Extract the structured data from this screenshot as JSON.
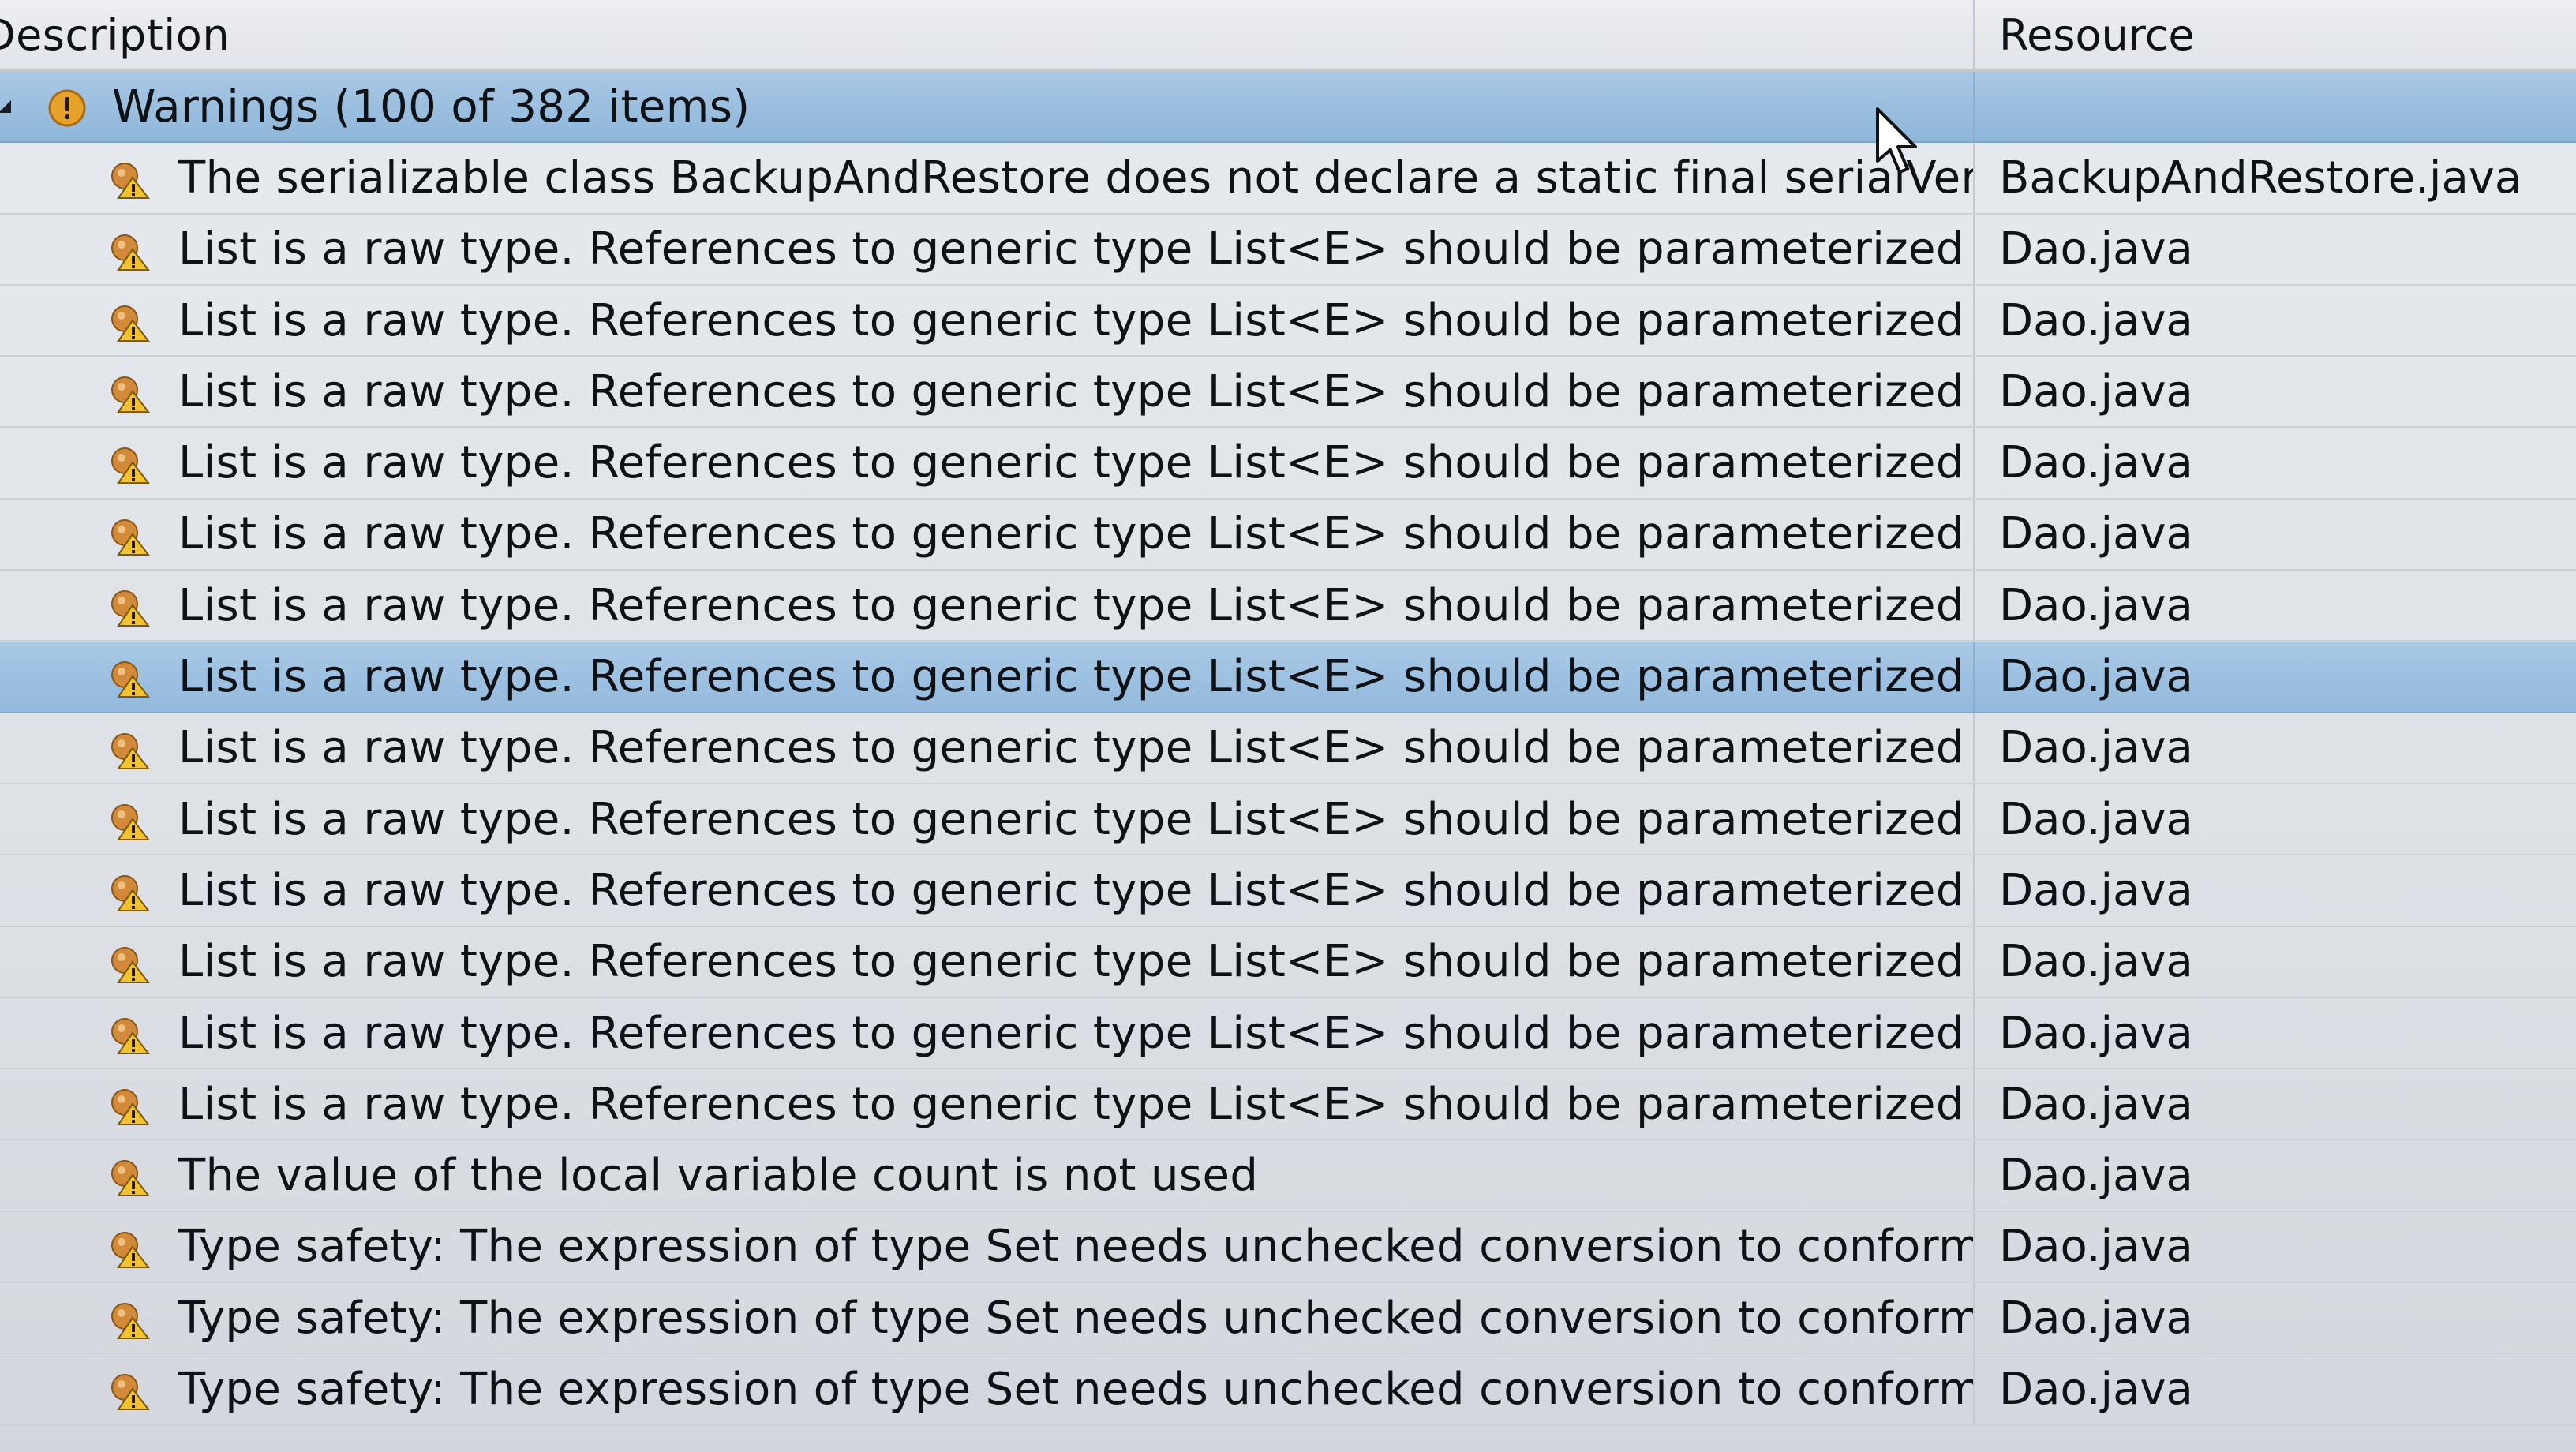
{
  "columns": {
    "description": "Description",
    "resource": "Resource"
  },
  "group": {
    "label": "Warnings (100 of 382 items)",
    "icon": "warning-icon"
  },
  "rows": [
    {
      "description": "The serializable class BackupAndRestore does not declare a static final serialVersionUID",
      "resource": "BackupAndRestore.java",
      "selected": false
    },
    {
      "description": "List is a raw type. References to generic type List<E> should be parameterized",
      "resource": "Dao.java",
      "selected": false
    },
    {
      "description": "List is a raw type. References to generic type List<E> should be parameterized",
      "resource": "Dao.java",
      "selected": false
    },
    {
      "description": "List is a raw type. References to generic type List<E> should be parameterized",
      "resource": "Dao.java",
      "selected": false
    },
    {
      "description": "List is a raw type. References to generic type List<E> should be parameterized",
      "resource": "Dao.java",
      "selected": false
    },
    {
      "description": "List is a raw type. References to generic type List<E> should be parameterized",
      "resource": "Dao.java",
      "selected": false
    },
    {
      "description": "List is a raw type. References to generic type List<E> should be parameterized",
      "resource": "Dao.java",
      "selected": false
    },
    {
      "description": "List is a raw type. References to generic type List<E> should be parameterized",
      "resource": "Dao.java",
      "selected": true
    },
    {
      "description": "List is a raw type. References to generic type List<E> should be parameterized",
      "resource": "Dao.java",
      "selected": false
    },
    {
      "description": "List is a raw type. References to generic type List<E> should be parameterized",
      "resource": "Dao.java",
      "selected": false
    },
    {
      "description": "List is a raw type. References to generic type List<E> should be parameterized",
      "resource": "Dao.java",
      "selected": false
    },
    {
      "description": "List is a raw type. References to generic type List<E> should be parameterized",
      "resource": "Dao.java",
      "selected": false
    },
    {
      "description": "List is a raw type. References to generic type List<E> should be parameterized",
      "resource": "Dao.java",
      "selected": false
    },
    {
      "description": "List is a raw type. References to generic type List<E> should be parameterized",
      "resource": "Dao.java",
      "selected": false
    },
    {
      "description": "The value of the local variable count is not used",
      "resource": "Dao.java",
      "selected": false
    },
    {
      "description": "Type safety: The expression of type Set needs unchecked conversion to conform to Set<String>",
      "resource": "Dao.java",
      "selected": false
    },
    {
      "description": "Type safety: The expression of type Set needs unchecked conversion to conform to Set<String>",
      "resource": "Dao.java",
      "selected": false
    },
    {
      "description": "Type safety: The expression of type Set needs unchecked conversion to conform to Set<String>",
      "resource": "Dao.java",
      "selected": false
    }
  ],
  "colors": {
    "selection": "#9fc2e2",
    "warning": "#e0a020"
  }
}
